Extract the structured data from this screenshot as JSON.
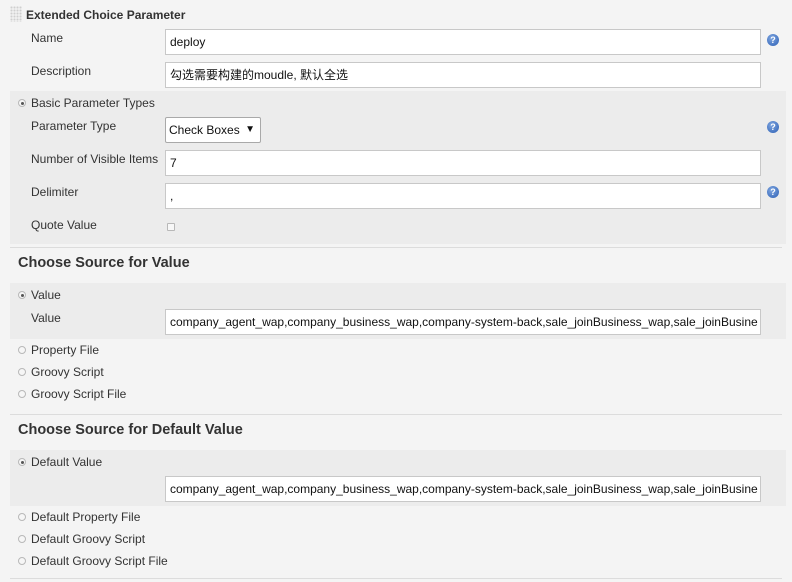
{
  "header": {
    "title": "Extended Choice Parameter"
  },
  "fields": {
    "name": {
      "label": "Name",
      "value": "deploy"
    },
    "description": {
      "label": "Description",
      "value": "勾选需要构建的moudle, 默认全选"
    }
  },
  "basic_types": {
    "label": "Basic Parameter Types",
    "parameter_type": {
      "label": "Parameter Type",
      "value": "Check Boxes"
    },
    "visible_items": {
      "label": "Number of Visible Items",
      "value": "7"
    },
    "delimiter": {
      "label": "Delimiter",
      "value": ","
    },
    "quote_value": {
      "label": "Quote Value"
    }
  },
  "source_value": {
    "title": "Choose Source for Value",
    "option_value": "Value",
    "value_label": "Value",
    "value": "company_agent_wap,company_business_wap,company-system-back,sale_joinBusiness_wap,sale_joinBusine",
    "option_property_file": "Property File",
    "option_groovy_script": "Groovy Script",
    "option_groovy_script_file": "Groovy Script File"
  },
  "source_default": {
    "title": "Choose Source for Default Value",
    "option_default_value": "Default Value",
    "value": "company_agent_wap,company_business_wap,company-system-back,sale_joinBusiness_wap,sale_joinBusine",
    "option_default_property_file": "Default Property File",
    "option_default_groovy_script": "Default Groovy Script",
    "option_default_groovy_script_file": "Default Groovy Script File"
  },
  "icons": {
    "help": "help-icon",
    "help_glyph": "?"
  }
}
